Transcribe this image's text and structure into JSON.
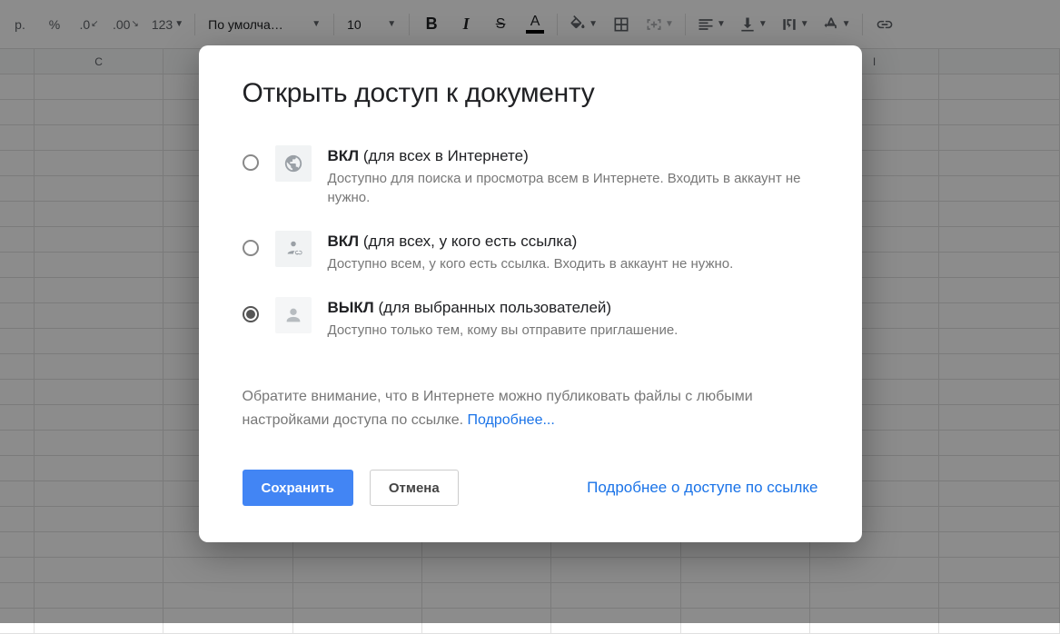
{
  "toolbar": {
    "currency_rub": "р.",
    "percent": "%",
    "dec_decrease": ".0",
    "dec_increase": ".00",
    "more_formats": "123",
    "font": "По умолча…",
    "font_size": "10"
  },
  "columns": [
    "",
    "C",
    "",
    "",
    "",
    "",
    "",
    "I",
    ""
  ],
  "dialog": {
    "title": "Открыть доступ к документу",
    "options": [
      {
        "title_bold": "ВКЛ",
        "title_rest": " (для всех в Интернете)",
        "desc": "Доступно для поиска и просмотра всем в Интернете. Входить в аккаунт не нужно.",
        "checked": false
      },
      {
        "title_bold": "ВКЛ",
        "title_rest": " (для всех, у кого есть ссылка)",
        "desc": "Доступно всем, у кого есть ссылка. Входить в аккаунт не нужно.",
        "checked": false
      },
      {
        "title_bold": "ВЫКЛ",
        "title_rest": " (для выбранных пользователей)",
        "desc": "Доступно только тем, кому вы отправите приглашение.",
        "checked": true
      }
    ],
    "note_text": "Обратите внимание, что в Интернете можно публиковать файлы с любыми настройками доступа по ссылке. ",
    "note_link": "Подробнее...",
    "save": "Сохранить",
    "cancel": "Отмена",
    "footer_link": "Подробнее о доступе по ссылке"
  }
}
